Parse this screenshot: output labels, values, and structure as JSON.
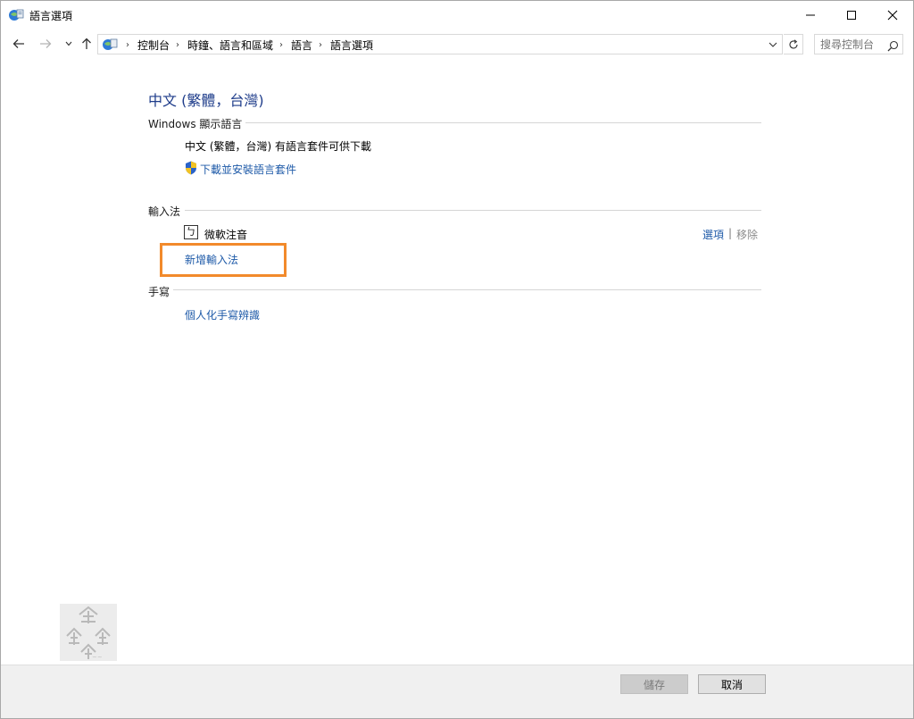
{
  "window": {
    "title": "語言選項",
    "minimize_icon": "minimize-icon",
    "maximize_icon": "maximize-icon",
    "close_icon": "close-icon"
  },
  "address": {
    "icon": "control-panel-icon",
    "breadcrumbs": [
      "控制台",
      "時鐘、語言和區域",
      "語言",
      "語言選項"
    ],
    "search_placeholder": "搜尋控制台"
  },
  "language": {
    "title": "中文 (繁體，台灣)"
  },
  "display_language": {
    "heading": "Windows 顯示語言",
    "status": "中文 (繁體，台灣) 有語言套件可供下載",
    "download_link": "下載並安裝語言套件"
  },
  "input_methods": {
    "heading": "輸入法",
    "items": [
      {
        "icon_glyph": "ㄅ",
        "name": "微軟注音",
        "options_label": "選項",
        "remove_label": "移除"
      }
    ],
    "add_link": "新增輸入法"
  },
  "handwriting": {
    "heading": "手寫",
    "personalize_link": "個人化手寫辨識"
  },
  "footer": {
    "save_label": "儲存",
    "cancel_label": "取消"
  },
  "colors": {
    "accent_link": "#1e5aa8",
    "title_blue": "#1e3c8a",
    "highlight_orange": "#f28a2b"
  }
}
